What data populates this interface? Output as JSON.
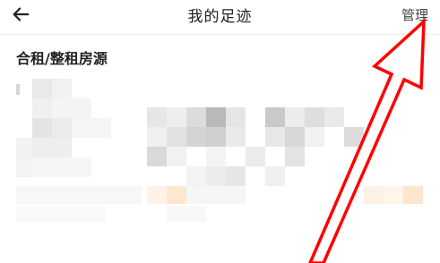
{
  "header": {
    "back_icon": "back-arrow-icon",
    "title": "我的足迹",
    "manage_label": "管理"
  },
  "section": {
    "title": "合租/整租房源"
  },
  "annotation": {
    "arrow_color": "#ff0000",
    "arrow_icon": "red-outline-arrow"
  },
  "colors": {
    "divider": "#ececec",
    "highlight_tint": "#fde8cf"
  }
}
